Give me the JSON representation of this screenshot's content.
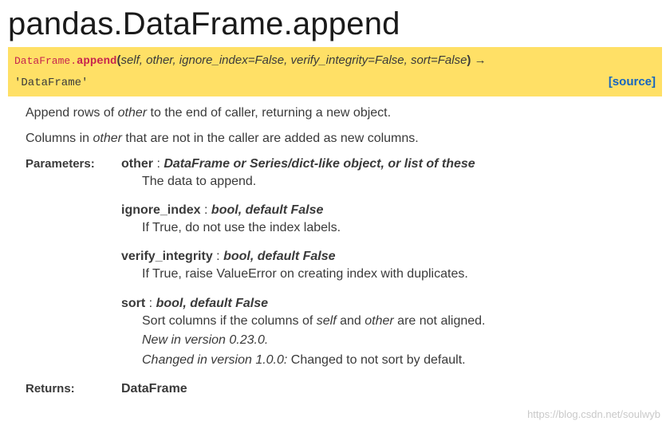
{
  "title": "pandas.DataFrame.append",
  "signature": {
    "classname": "DataFrame.",
    "funcname": "append",
    "open": "(",
    "args": "self, other, ignore_index=False, verify_integrity=False, sort=False",
    "close": ")",
    "arrow": " → ",
    "returns": "'DataFrame'",
    "source_label": "[source]"
  },
  "description": {
    "line1_pre": "Append rows of ",
    "line1_em": "other",
    "line1_post": " to the end of caller, returning a new object.",
    "line2_pre": "Columns in ",
    "line2_em": "other",
    "line2_post": " that are not in the caller are added as new columns."
  },
  "labels": {
    "parameters": "Parameters:",
    "returns": "Returns:"
  },
  "params": [
    {
      "name": "other",
      "sep": " : ",
      "type": "DataFrame or Series/dict-like object, or list of these",
      "desc": "The data to append."
    },
    {
      "name": "ignore_index",
      "sep": " : ",
      "type": "bool, default False",
      "desc": "If True, do not use the index labels."
    },
    {
      "name": "verify_integrity",
      "sep": " : ",
      "type": "bool, default False",
      "desc": "If True, raise ValueError on creating index with duplicates."
    },
    {
      "name": "sort",
      "sep": " : ",
      "type": "bool, default False",
      "desc_pre": "Sort columns if the columns of ",
      "desc_em1": "self",
      "desc_mid": " and ",
      "desc_em2": "other",
      "desc_post": " are not aligned.",
      "version_new": "New in version 0.23.0.",
      "version_changed_label": "Changed in version 1.0.0:",
      "version_changed_text": " Changed to not sort by default."
    }
  ],
  "returns_type": "DataFrame",
  "watermark": "https://blog.csdn.net/soulwyb"
}
